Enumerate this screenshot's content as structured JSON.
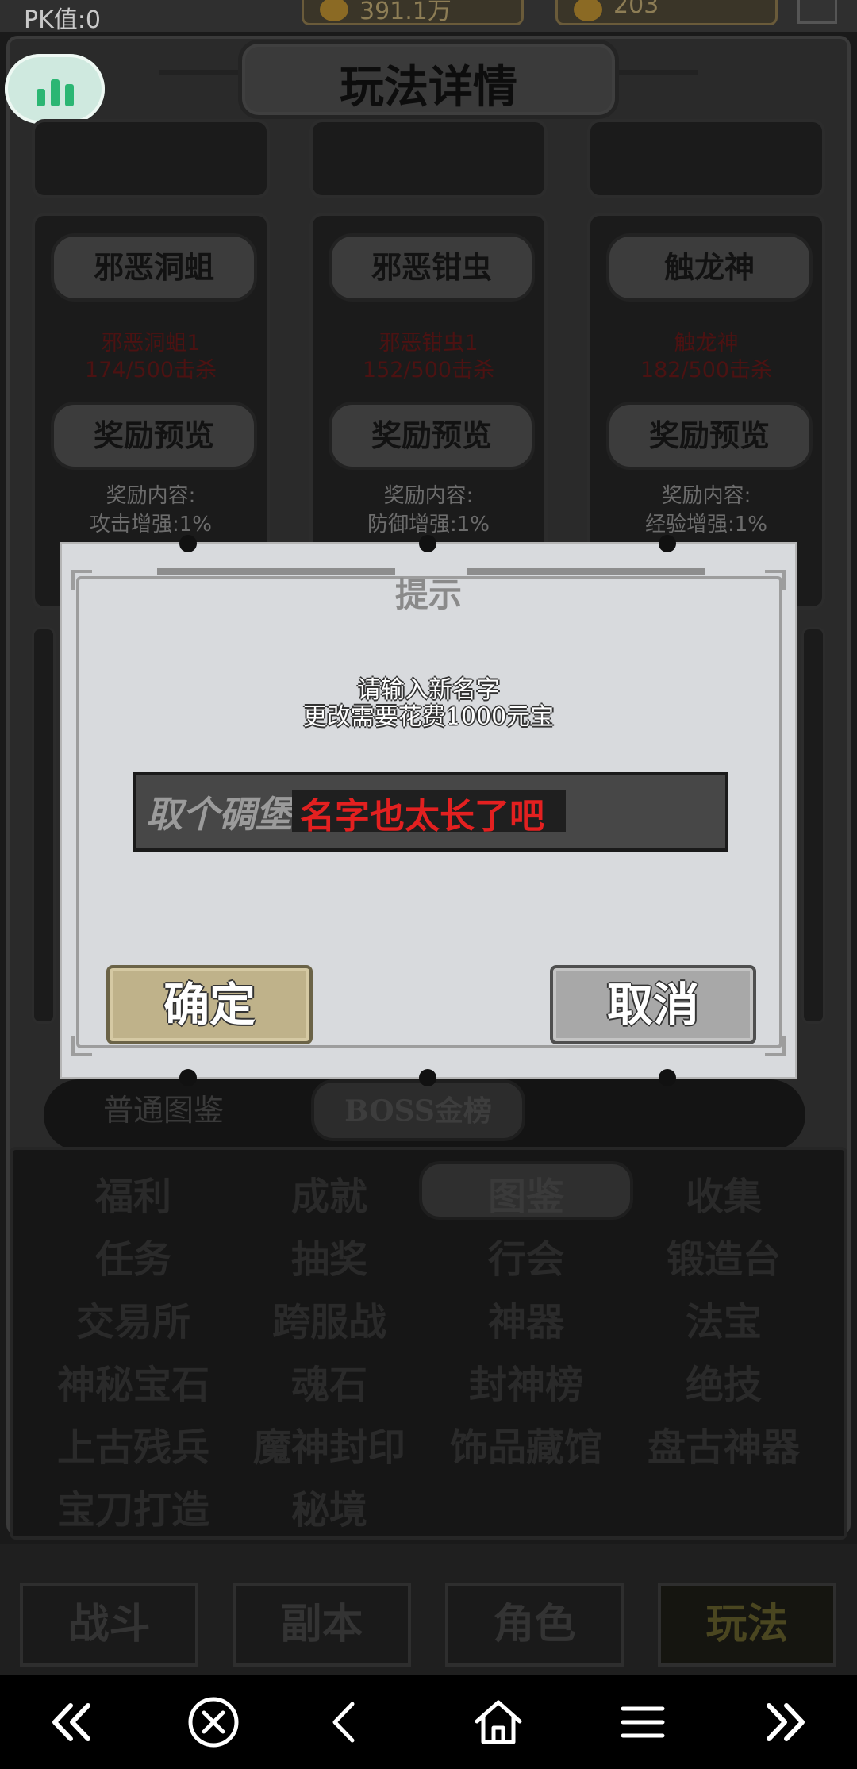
{
  "status": {
    "pk_label": "PK值:0",
    "currency_1": "391.1万",
    "currency_2": "203"
  },
  "page": {
    "title": "玩法详情"
  },
  "bosses": [
    {
      "name": "邪恶洞蛆",
      "kill_name": "邪恶洞蛆1",
      "kill_progress": "174/500击杀",
      "reward_button": "奖励预览",
      "reward_label": "奖励内容:",
      "reward_value": "攻击增强:1%"
    },
    {
      "name": "邪恶钳虫",
      "kill_name": "邪恶钳虫1",
      "kill_progress": "152/500击杀",
      "reward_button": "奖励预览",
      "reward_label": "奖励内容:",
      "reward_value": "防御增强:1%"
    },
    {
      "name": "触龙神",
      "kill_name": "触龙神",
      "kill_progress": "182/500击杀",
      "reward_button": "奖励预览",
      "reward_label": "奖励内容:",
      "reward_value": "经验增强:1%"
    }
  ],
  "sub_tabs": {
    "normal": "普通图鉴",
    "boss": "BOSS金榜"
  },
  "menu": {
    "items": [
      "福利",
      "成就",
      "图鉴",
      "收集",
      "任务",
      "抽奖",
      "行会",
      "锻造台",
      "交易所",
      "跨服战",
      "神器",
      "法宝",
      "神秘宝石",
      "魂石",
      "封神榜",
      "绝技",
      "上古残兵",
      "魔神封印",
      "饰品藏馆",
      "盘古神器",
      "宝刀打造",
      "秘境"
    ],
    "active": "图鉴"
  },
  "bottom_tabs": [
    "战斗",
    "副本",
    "角色",
    "玩法"
  ],
  "bottom_active": "玩法",
  "dialog": {
    "title": "提示",
    "prompt_line1": "请输入新名字",
    "prompt_line2": "更改需要花费1000元宝",
    "input_value": "取个碉堡",
    "overflow_text": "名字也太长了吧",
    "confirm": "确定",
    "cancel": "取消"
  },
  "colors": {
    "dialog_bg": "#d8dadd",
    "warning_red": "#e32020",
    "confirm_gold": "#bfb28a",
    "cancel_gray": "#a8a8a8",
    "weather_green": "#2bb673"
  },
  "system_nav": [
    "double-left-icon",
    "close-circle-icon",
    "back-icon",
    "home-icon",
    "menu-icon",
    "double-right-icon"
  ]
}
